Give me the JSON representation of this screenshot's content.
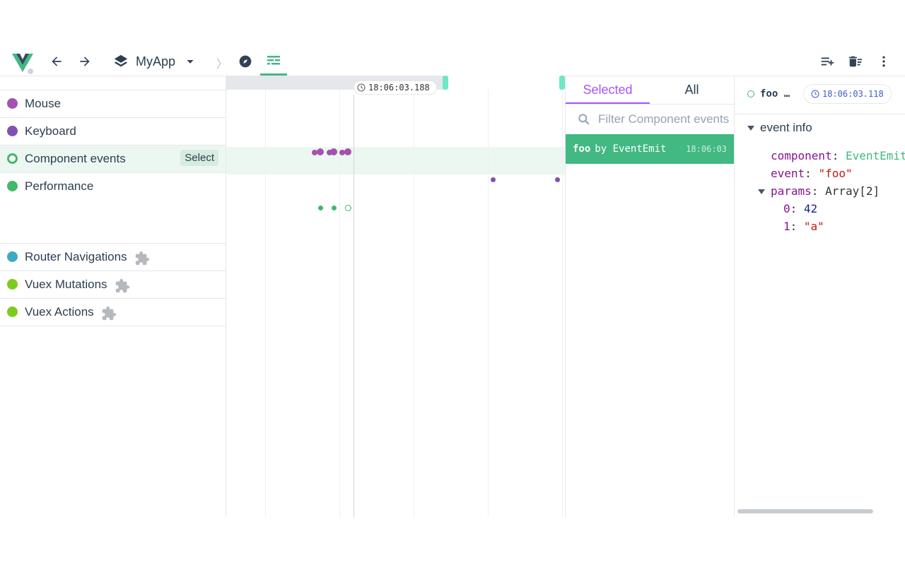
{
  "toolbar": {
    "app_name": "MyApp",
    "separator": "〉",
    "icons": [
      "vue-logo-icon",
      "arrow-back-icon",
      "arrow-forward-icon",
      "layers-icon",
      "chevron-down-icon",
      "compass-icon",
      "timeline-icon",
      "playlist-add-icon",
      "delete-sweep-icon",
      "more-vert-icon"
    ]
  },
  "layers": [
    {
      "name": "Mouse",
      "color": "#a451af",
      "plugin": false
    },
    {
      "name": "Keyboard",
      "color": "#8151af",
      "plugin": false
    },
    {
      "name": "Component events",
      "color": "#41b86a",
      "plugin": false,
      "selected": true,
      "select_label": "Select"
    },
    {
      "name": "Performance",
      "color": "#41b86a",
      "plugin": false
    },
    {
      "name": "Router Navigations",
      "color": "#40a8c4",
      "plugin": true
    },
    {
      "name": "Vuex Mutations",
      "color": "#7dcb1e",
      "plugin": true
    },
    {
      "name": "Vuex Actions",
      "color": "#7dcb1e",
      "plugin": true
    }
  ],
  "timeline": {
    "cursor_time": "18:06:03.188"
  },
  "events_panel": {
    "tabs": [
      "Selected",
      "All"
    ],
    "active_tab": "Selected",
    "filter_placeholder": "Filter Component events",
    "items": [
      {
        "name": "foo",
        "by": "by EventEmit",
        "time": "18:06:03"
      }
    ]
  },
  "inspector": {
    "event_name": "foo …",
    "time": "18:06:03.118",
    "section_title": "event info",
    "props": {
      "component_key": "component",
      "component_value": "EventEmit",
      "event_key": "event",
      "event_value": "\"foo\"",
      "params_key": "params",
      "params_type": "Array[2]",
      "p0_key": "0",
      "p0_value": "42",
      "p1_key": "1",
      "p1_value": "\"a\""
    }
  },
  "colors": {
    "accent_green": "#42b883",
    "tab_purple": "#a855f7"
  }
}
